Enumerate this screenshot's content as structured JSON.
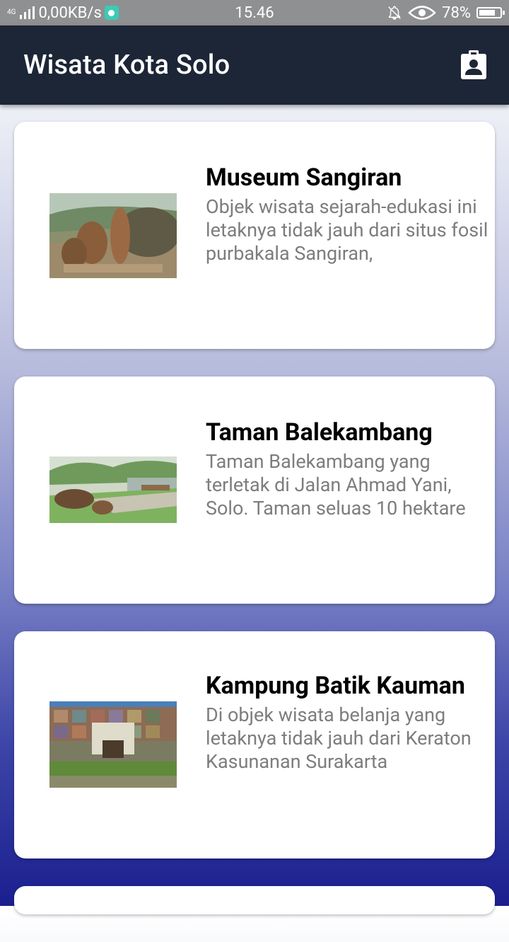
{
  "status_bar": {
    "network": "4G",
    "data_speed": "0,00KB/s",
    "time": "15.46",
    "battery_percent": "78%",
    "battery_level": 0.78
  },
  "app_bar": {
    "title": "Wisata Kota Solo",
    "action_icon": "account-box-icon"
  },
  "places": [
    {
      "name": "Museum Sangiran",
      "description": "Objek wisata sejarah-edukasi ini letaknya tidak jauh dari situs fosil purbakala Sangiran,"
    },
    {
      "name": "Taman Balekambang",
      "description": "Taman Balekambang yang terletak di Jalan Ahmad Yani, Solo. Taman seluas 10 hektare"
    },
    {
      "name": "Kampung Batik Kauman",
      "description": "Di objek wisata belanja yang letaknya tidak jauh dari Keraton Kasunanan Surakarta"
    }
  ]
}
